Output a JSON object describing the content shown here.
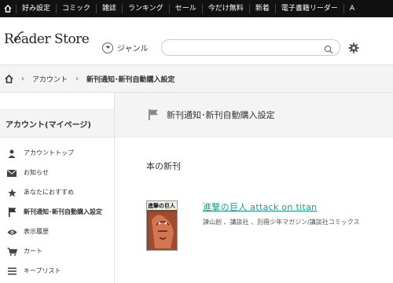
{
  "topnav": {
    "items": [
      "好み設定",
      "コミック",
      "雑誌",
      "ランキング",
      "セール",
      "今だけ無料",
      "新着",
      "電子書籍リーダー",
      "A"
    ]
  },
  "header": {
    "logo": "Reader Store",
    "genre_label": "ジャンル",
    "search": {
      "value": "",
      "placeholder": ""
    }
  },
  "breadcrumb": {
    "items": [
      "アカウント",
      "新刊通知･新刊自動購入設定"
    ]
  },
  "sidebar": {
    "title": "アカウント(マイページ)",
    "items": [
      {
        "label": "アカウントトップ",
        "icon": "person-icon"
      },
      {
        "label": "お知らせ",
        "icon": "envelope-icon"
      },
      {
        "label": "あなたにおすすめ",
        "icon": "star-icon"
      },
      {
        "label": "新刊通知･新刊自動購入設定",
        "icon": "flag-icon"
      },
      {
        "label": "表示履歴",
        "icon": "eye-icon"
      },
      {
        "label": "カート",
        "icon": "cart-icon"
      },
      {
        "label": "キープリスト",
        "icon": "list-icon"
      }
    ]
  },
  "main": {
    "header_title": "新刊通知･新刊自動購入設定",
    "section_title": "本の新刊",
    "book": {
      "title": "進撃の巨人 attack on titan",
      "meta": "諫山創 、講談社 、別冊少年マガジン/講談社コミックス",
      "cover_title": "進撃の巨人"
    }
  },
  "colors": {
    "topnav_bg": "#111111",
    "link_teal": "#1a9a8f",
    "panel_bg": "#f4f4f4"
  }
}
